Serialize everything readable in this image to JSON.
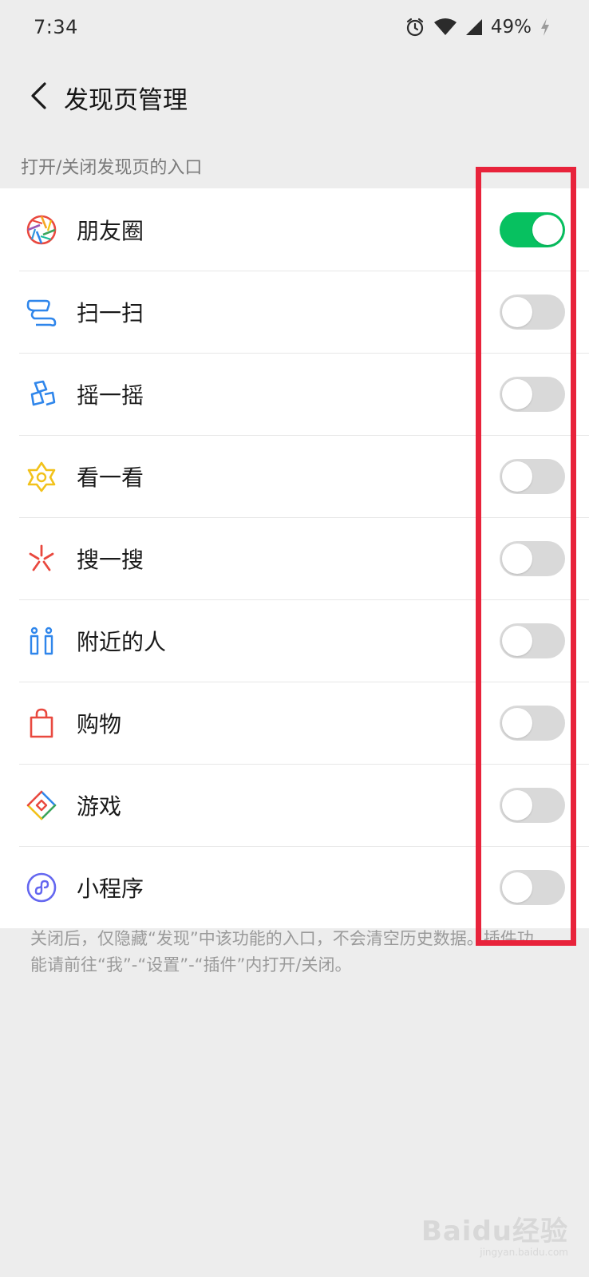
{
  "status_bar": {
    "time": "7:34",
    "battery": "49%"
  },
  "header": {
    "title": "发现页管理"
  },
  "section_label": "打开/关闭发现页的入口",
  "items": [
    {
      "label": "朋友圈",
      "enabled": true,
      "icon": "moments-icon"
    },
    {
      "label": "扫一扫",
      "enabled": false,
      "icon": "scan-icon"
    },
    {
      "label": "摇一摇",
      "enabled": false,
      "icon": "shake-icon"
    },
    {
      "label": "看一看",
      "enabled": false,
      "icon": "top-stories-icon"
    },
    {
      "label": "搜一搜",
      "enabled": false,
      "icon": "search-icon"
    },
    {
      "label": "附近的人",
      "enabled": false,
      "icon": "people-nearby-icon"
    },
    {
      "label": "购物",
      "enabled": false,
      "icon": "shopping-bag-icon"
    },
    {
      "label": "游戏",
      "enabled": false,
      "icon": "games-icon"
    },
    {
      "label": "小程序",
      "enabled": false,
      "icon": "mini-programs-icon"
    }
  ],
  "footnote": "关闭后，仅隐藏“发现”中该功能的入口，不会清空历史数据。插件功能请前往“我”-“设置”-“插件”内打开/关闭。",
  "watermark": {
    "main": "Baidu经验",
    "sub": "jingyan.baidu.com"
  },
  "colors": {
    "toggle_on": "#07c160",
    "toggle_off": "#d9d9d9",
    "highlight": "#e8233b",
    "background": "#ededed"
  }
}
